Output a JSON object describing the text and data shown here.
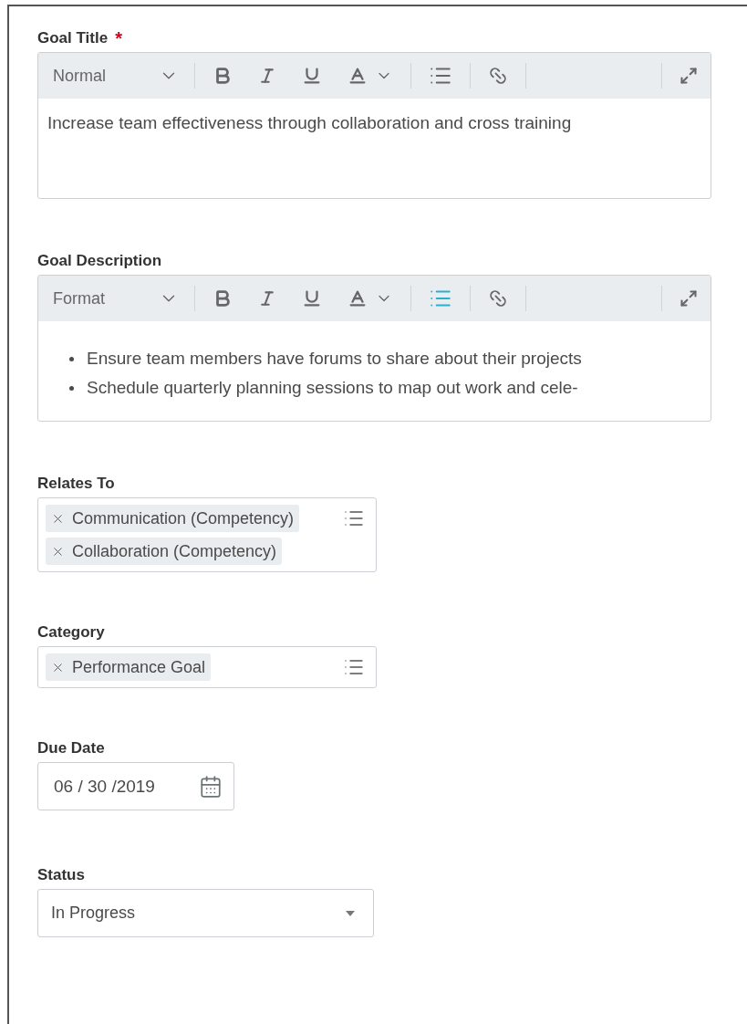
{
  "fields": [
    {
      "kind": "richtext",
      "label": "Goal Title",
      "required_mark": "*",
      "format": "Normal",
      "list_active": false,
      "paragraphs": [
        "Increase team effectiveness through collaboration and cross training"
      ]
    },
    {
      "kind": "richtext",
      "label": "Goal Description",
      "format": "Format",
      "list_active": true,
      "bullets": [
        "Ensure team members have forums to share about their projects",
        "Schedule quarterly planning sessions to map out work and cele-"
      ]
    },
    {
      "kind": "multiselect",
      "label": "Relates To",
      "tags": [
        "Communication (Competency)",
        "Collaboration (Competency)"
      ]
    },
    {
      "kind": "multiselect",
      "label": "Category",
      "tags": [
        "Performance Goal"
      ]
    },
    {
      "kind": "date",
      "label": "Due Date",
      "value": "06 / 30 /2019"
    },
    {
      "kind": "select",
      "label": "Status",
      "value": "In Progress"
    }
  ]
}
